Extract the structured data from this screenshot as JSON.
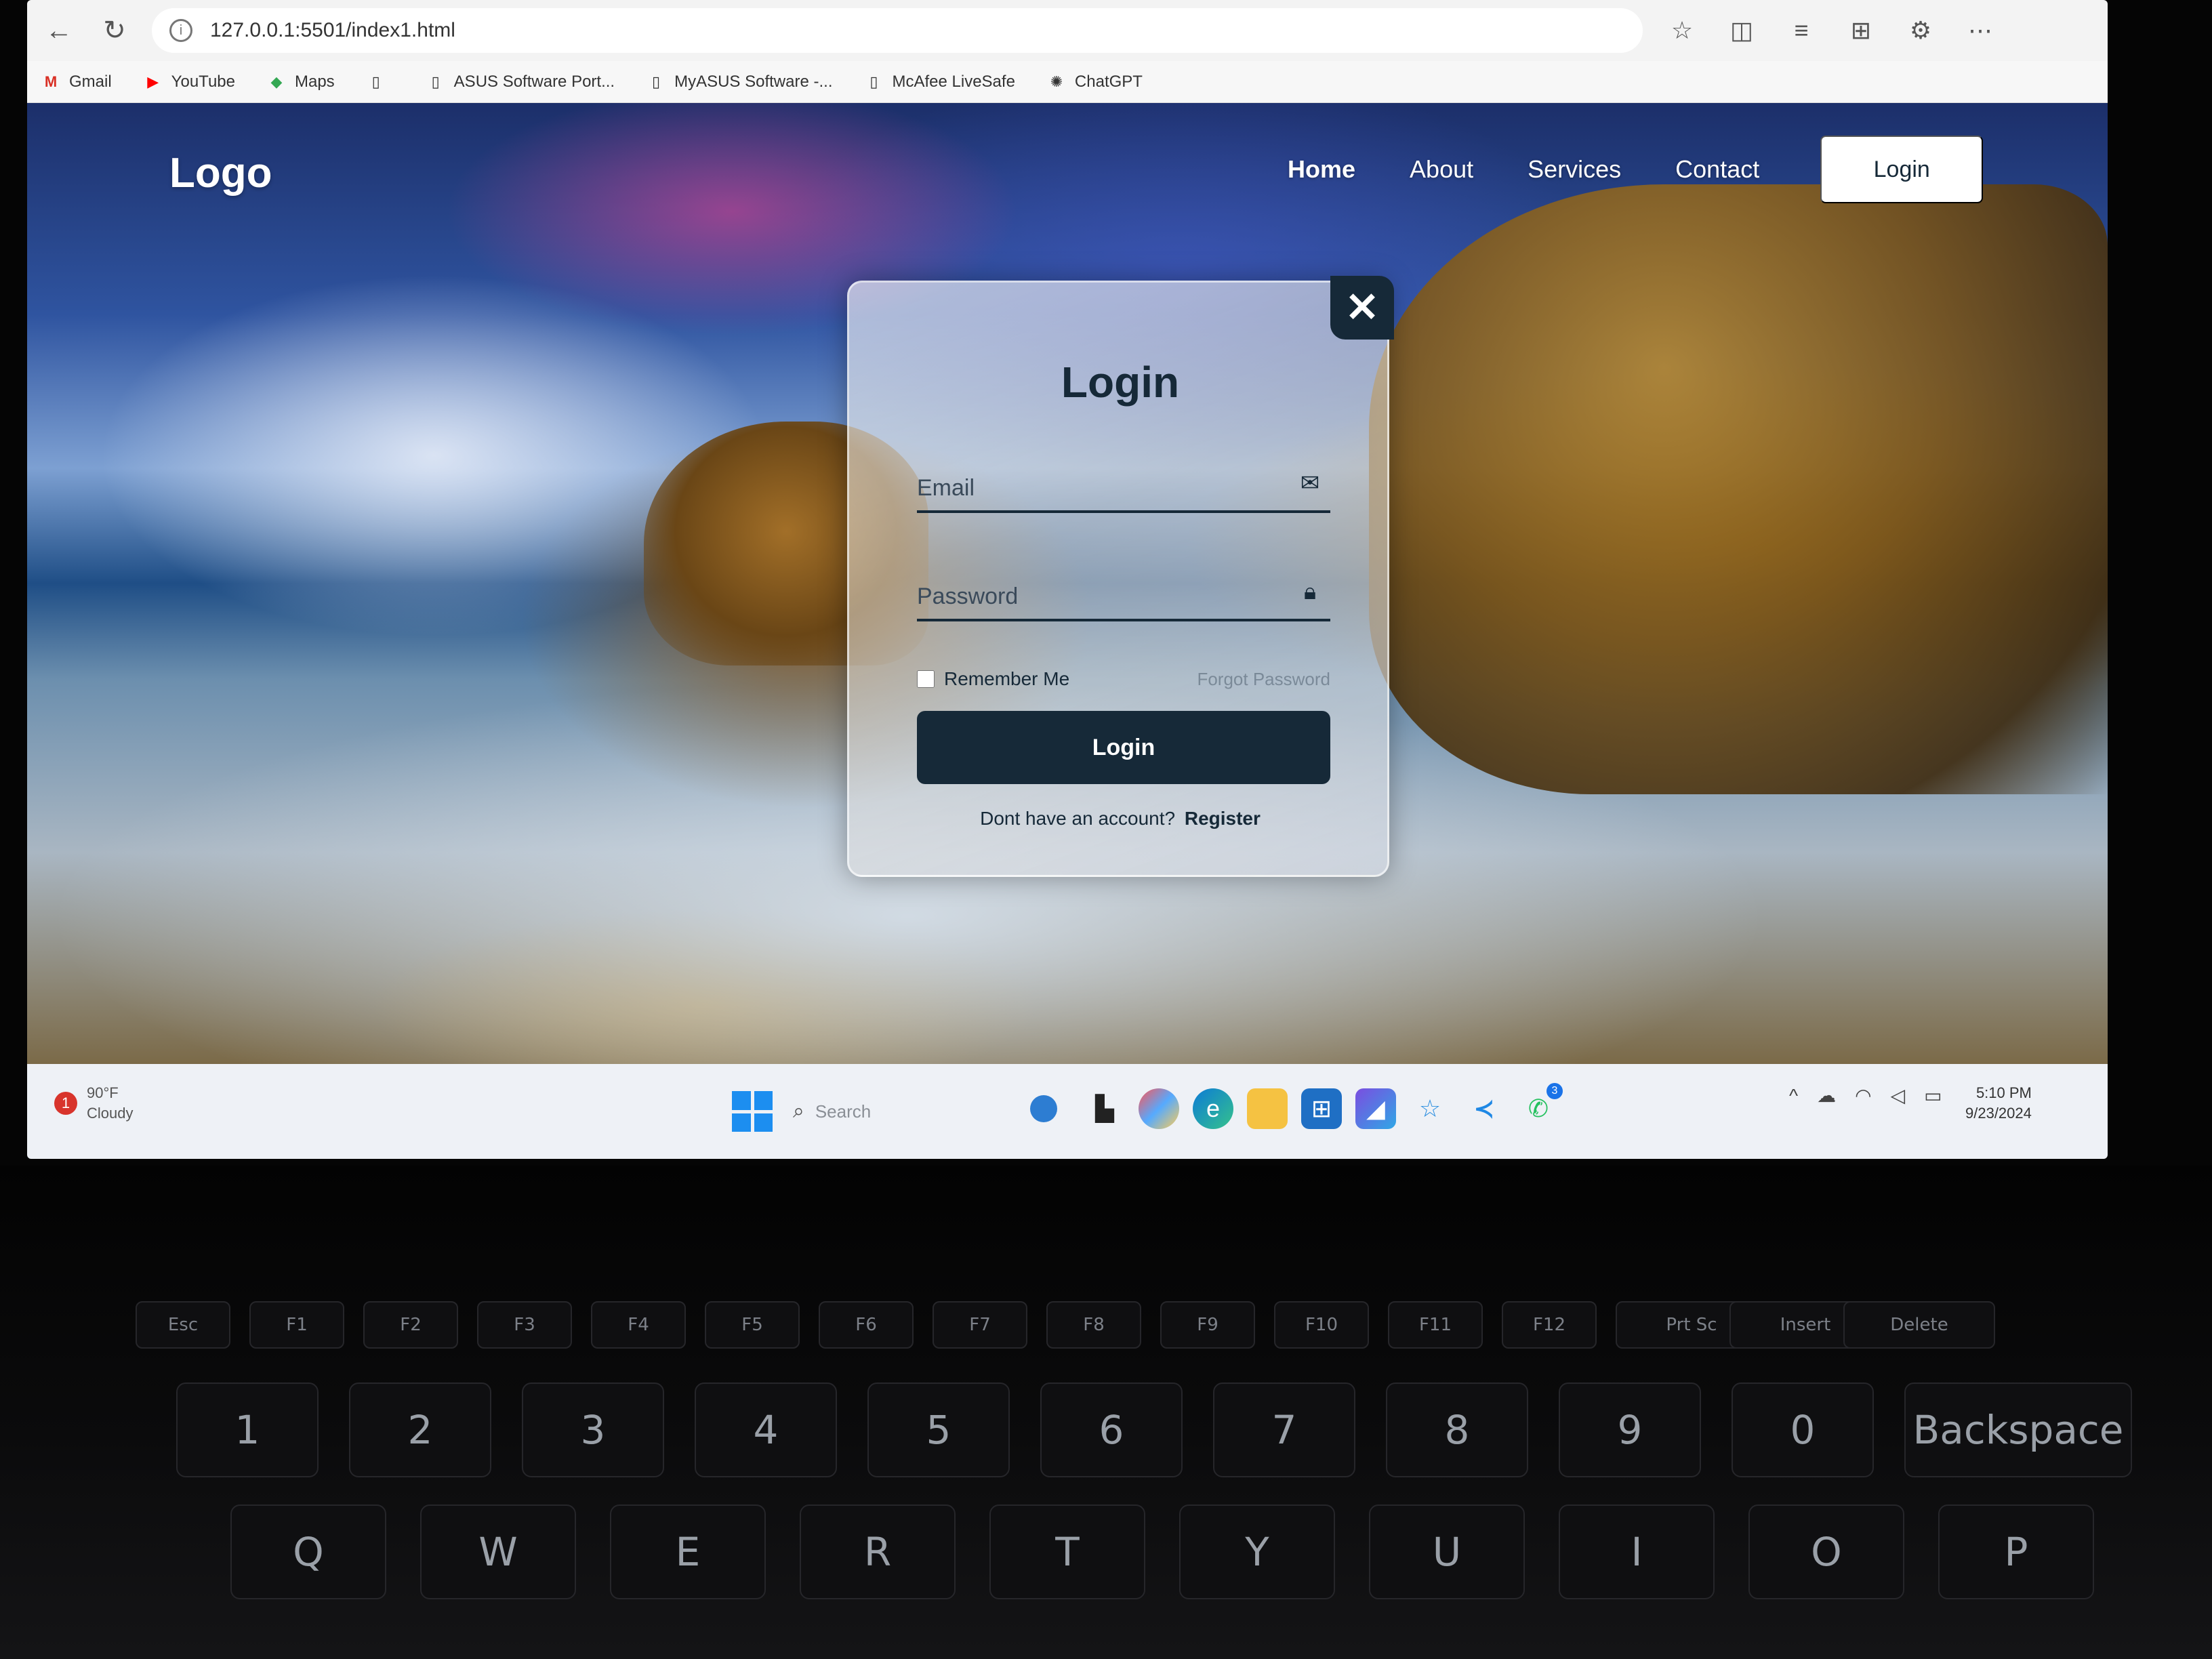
{
  "browser": {
    "url": "127.0.0.1:5501/index1.html",
    "bookmarks": [
      {
        "label": "Gmail",
        "icon": "gmail-icon"
      },
      {
        "label": "YouTube",
        "icon": "youtube-icon"
      },
      {
        "label": "Maps",
        "icon": "maps-icon"
      },
      {
        "label": "",
        "icon": "page-icon"
      },
      {
        "label": "ASUS Software Port...",
        "icon": "page-icon"
      },
      {
        "label": "MyASUS Software -...",
        "icon": "page-icon"
      },
      {
        "label": "McAfee LiveSafe",
        "icon": "page-icon"
      },
      {
        "label": "ChatGPT",
        "icon": "chatgpt-icon"
      }
    ]
  },
  "site": {
    "logo": "Logo",
    "nav": {
      "home": "Home",
      "about": "About",
      "services": "Services",
      "contact": "Contact",
      "login_button": "Login"
    }
  },
  "login_modal": {
    "close_symbol": "✕",
    "title": "Login",
    "email_placeholder": "Email",
    "password_placeholder": "Password",
    "remember_label": "Remember Me",
    "forgot_link": "Forgot Password",
    "submit_label": "Login",
    "register_prompt": "Dont have an account?",
    "register_link": "Register"
  },
  "taskbar": {
    "weather_alert_count": "1",
    "weather_temp": "90°F",
    "weather_desc": "Cloudy",
    "search_placeholder": "Search",
    "whatsapp_badge": "3",
    "time": "5:10 PM",
    "date": "9/23/2024"
  },
  "keyboard": {
    "function_row": [
      "Esc",
      "F1",
      "F2",
      "F3",
      "F4",
      "F5",
      "F6",
      "F7",
      "F8",
      "F9",
      "F10",
      "F11",
      "F12",
      "Prt Sc",
      "Insert",
      "Delete"
    ],
    "number_row": [
      "1",
      "2",
      "3",
      "4",
      "5",
      "6",
      "7",
      "8",
      "9",
      "0",
      "Backspace"
    ],
    "letter_row": [
      "Q",
      "W",
      "E",
      "R",
      "T",
      "Y",
      "U",
      "I",
      "O",
      "P"
    ]
  },
  "colors": {
    "brand_dark": "#162938",
    "close_button": "#162938",
    "taskbar": "#eef1f6"
  }
}
